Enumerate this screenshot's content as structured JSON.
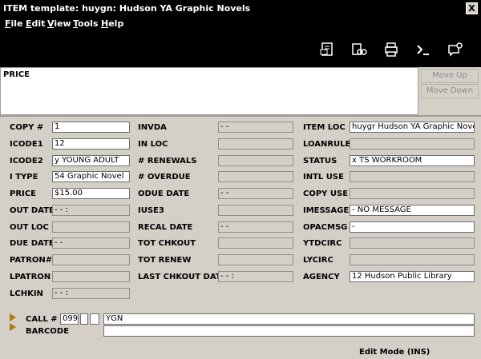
{
  "window": {
    "title": "ITEM template: huygn: Hudson YA Graphic Novels",
    "close_label": "X"
  },
  "menu": [
    {
      "hotkey": "F",
      "rest": "ile"
    },
    {
      "hotkey": "E",
      "rest": "dit"
    },
    {
      "hotkey": "V",
      "rest": "iew"
    },
    {
      "hotkey": "T",
      "rest": "ools"
    },
    {
      "hotkey": "H",
      "rest": "elp"
    }
  ],
  "toolbar": {
    "icons": [
      "record-icon",
      "binoculars-icon",
      "print-icon",
      "command-prompt-icon",
      "message-icon"
    ]
  },
  "price_area": {
    "label": "PRICE"
  },
  "side_buttons": {
    "move_up": "Move Up",
    "move_down": "Move Down"
  },
  "fields": {
    "col1": [
      {
        "label": "COPY #",
        "value": "1"
      },
      {
        "label": "ICODE1",
        "value": "12"
      },
      {
        "label": "ICODE2",
        "value": "y  YOUNG ADULT"
      },
      {
        "label": "I TYPE",
        "value": "54  Graphic Novel"
      },
      {
        "label": "PRICE",
        "value": "$15.00"
      },
      {
        "label": "OUT DATE",
        "value": " - -        :"
      },
      {
        "label": "OUT LOC",
        "value": ""
      },
      {
        "label": "DUE DATE",
        "value": " - -"
      },
      {
        "label": "PATRON#",
        "value": ""
      },
      {
        "label": "LPATRON",
        "value": ""
      },
      {
        "label": "LCHKIN",
        "value": " - -        :"
      }
    ],
    "col2": [
      {
        "label": "INVDA",
        "value": " - -"
      },
      {
        "label": "IN LOC",
        "value": ""
      },
      {
        "label": "# RENEWALS",
        "value": ""
      },
      {
        "label": "# OVERDUE",
        "value": ""
      },
      {
        "label": "ODUE DATE",
        "value": " - -"
      },
      {
        "label": "IUSE3",
        "value": ""
      },
      {
        "label": "RECAL DATE",
        "value": " - -"
      },
      {
        "label": "TOT CHKOUT",
        "value": ""
      },
      {
        "label": "TOT RENEW",
        "value": ""
      },
      {
        "label": "LAST CHKOUT DATE",
        "value": " - -        :"
      }
    ],
    "col3": [
      {
        "label": "ITEM LOC",
        "value": "huygr  Hudson YA Graphic Novels"
      },
      {
        "label": "LOANRULE",
        "value": ""
      },
      {
        "label": "STATUS",
        "value": "x  TS WORKROOM"
      },
      {
        "label": "INTL USE",
        "value": ""
      },
      {
        "label": "COPY USE",
        "value": ""
      },
      {
        "label": "IMESSAGE",
        "value": "-  NO MESSAGE"
      },
      {
        "label": "OPACMSG",
        "value": "-"
      },
      {
        "label": "YTDCIRC",
        "value": ""
      },
      {
        "label": "LYCIRC",
        "value": ""
      },
      {
        "label": "AGENCY",
        "value": "12  Hudson Public Library"
      }
    ]
  },
  "call": {
    "label": "CALL #",
    "tag": "099",
    "ind1": "",
    "ind2": "",
    "value": "YGN"
  },
  "barcode": {
    "label": "BARCODE",
    "value": ""
  },
  "status_bar": {
    "mode": "Edit Mode (INS)"
  },
  "colors": {
    "chrome": "#000000",
    "panel": "#d4d0c8",
    "arrow": "#b07a10"
  }
}
